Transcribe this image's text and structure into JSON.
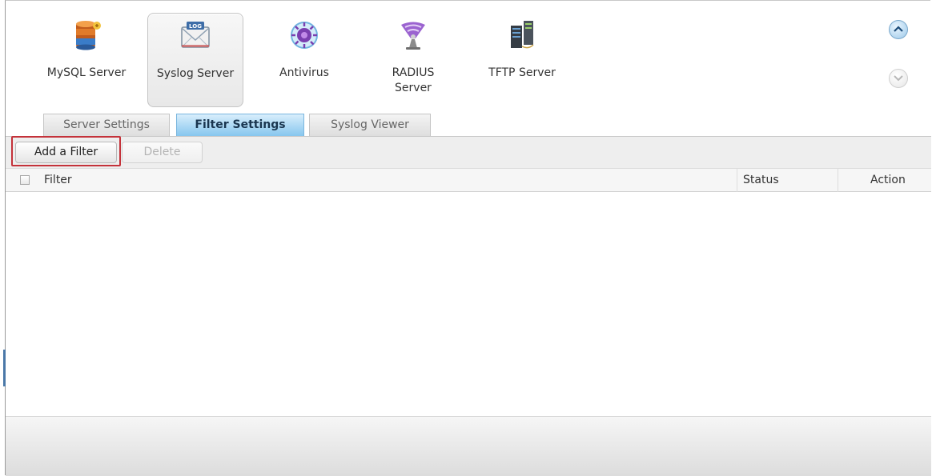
{
  "apps": [
    {
      "label_lines": [
        "MySQL Server"
      ],
      "icon": "mysql-server-icon",
      "selected": false
    },
    {
      "label_lines": [
        "Syslog Server"
      ],
      "icon": "syslog-server-icon",
      "selected": true
    },
    {
      "label_lines": [
        "Antivirus"
      ],
      "icon": "antivirus-icon",
      "selected": false
    },
    {
      "label_lines": [
        "RADIUS",
        "Server"
      ],
      "icon": "radius-server-icon",
      "selected": false
    },
    {
      "label_lines": [
        "TFTP Server"
      ],
      "icon": "tftp-server-icon",
      "selected": false
    }
  ],
  "scroll": {
    "up_icon": "scroll-up-icon",
    "down_icon": "scroll-down-icon"
  },
  "tabs": [
    {
      "label": "Server Settings",
      "active": false
    },
    {
      "label": "Filter Settings",
      "active": true
    },
    {
      "label": "Syslog Viewer",
      "active": false
    }
  ],
  "toolbar": {
    "add_label": "Add a Filter",
    "delete_label": "Delete"
  },
  "table": {
    "columns": [
      "Filter",
      "Status",
      "Action"
    ]
  },
  "colors": {
    "accent_tab": "#86c6ee",
    "highlight": "#c4323a"
  }
}
